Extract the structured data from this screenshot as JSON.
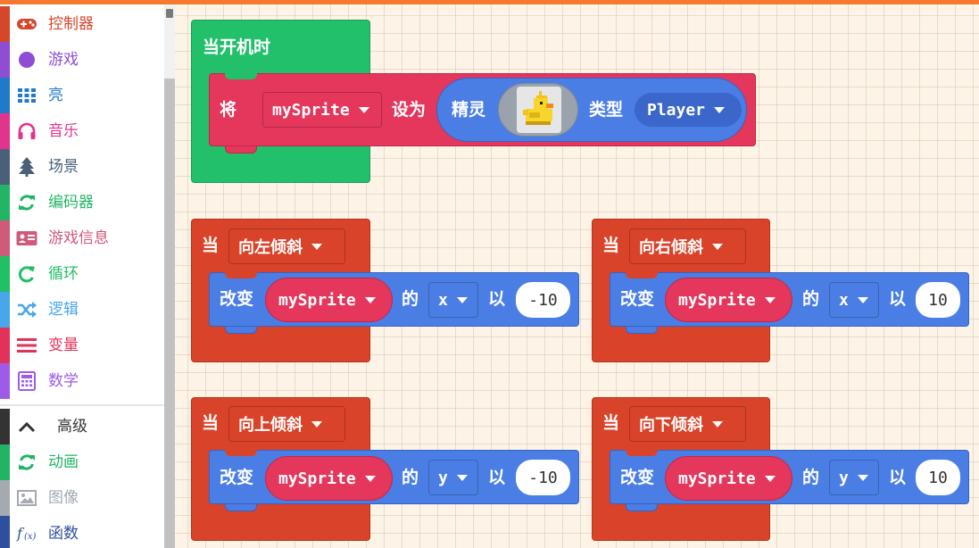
{
  "toolbox": {
    "items": [
      {
        "label": "控制器",
        "icon": "gamepad-icon",
        "color": "#d5472a"
      },
      {
        "label": "游戏",
        "icon": "circle-icon",
        "color": "#8f4cd4"
      },
      {
        "label": "亮",
        "icon": "grid-icon",
        "color": "#1f7ac9"
      },
      {
        "label": "音乐",
        "icon": "headphones-icon",
        "color": "#e0348d"
      },
      {
        "label": "场景",
        "icon": "tree-icon",
        "color": "#4a6079"
      },
      {
        "label": "编码器",
        "icon": "refresh-icon",
        "color": "#23b565"
      },
      {
        "label": "游戏信息",
        "icon": "id-card-icon",
        "color": "#cf5a7a"
      },
      {
        "label": "循环",
        "icon": "loop-icon",
        "color": "#22bf66"
      },
      {
        "label": "逻辑",
        "icon": "shuffle-icon",
        "color": "#48a6ea"
      },
      {
        "label": "变量",
        "icon": "list-icon",
        "color": "#e3325a"
      },
      {
        "label": "数学",
        "icon": "calculator-icon",
        "color": "#9e5be8"
      }
    ],
    "advanced": {
      "label": "高级",
      "icon": "chevron-up-icon"
    },
    "extra": [
      {
        "label": "动画",
        "icon": "refresh-icon",
        "color": "#22b365"
      },
      {
        "label": "图像",
        "icon": "image-icon",
        "color": "#a4aab0"
      },
      {
        "label": "函数",
        "icon": "function-icon",
        "color": "#2f4f9c"
      }
    ]
  },
  "blocks": {
    "on_start": {
      "hat": "当开机时",
      "set_label": "将",
      "set_var": "mySprite",
      "set_to": "设为",
      "sprite_label": "精灵",
      "sprite_image": "duck-sprite-icon",
      "kind_label": "类型",
      "kind_value": "Player"
    },
    "tilts": [
      {
        "when": "当",
        "event": "向左倾斜",
        "change": "改变",
        "var": "mySprite",
        "of": "的",
        "prop": "x",
        "by": "以",
        "value": "-10"
      },
      {
        "when": "当",
        "event": "向右倾斜",
        "change": "改变",
        "var": "mySprite",
        "of": "的",
        "prop": "x",
        "by": "以",
        "value": "10"
      },
      {
        "when": "当",
        "event": "向上倾斜",
        "change": "改变",
        "var": "mySprite",
        "of": "的",
        "prop": "y",
        "by": "以",
        "value": "-10"
      },
      {
        "when": "当",
        "event": "向下倾斜",
        "change": "改变",
        "var": "mySprite",
        "of": "的",
        "prop": "y",
        "by": "以",
        "value": "10"
      }
    ]
  },
  "colors": {
    "accent_bar": "#f57a2e",
    "events_red": "#d9432a",
    "start_green": "#23c06b",
    "variables_red": "#e5365c",
    "sprites_blue": "#4b7ee5"
  }
}
